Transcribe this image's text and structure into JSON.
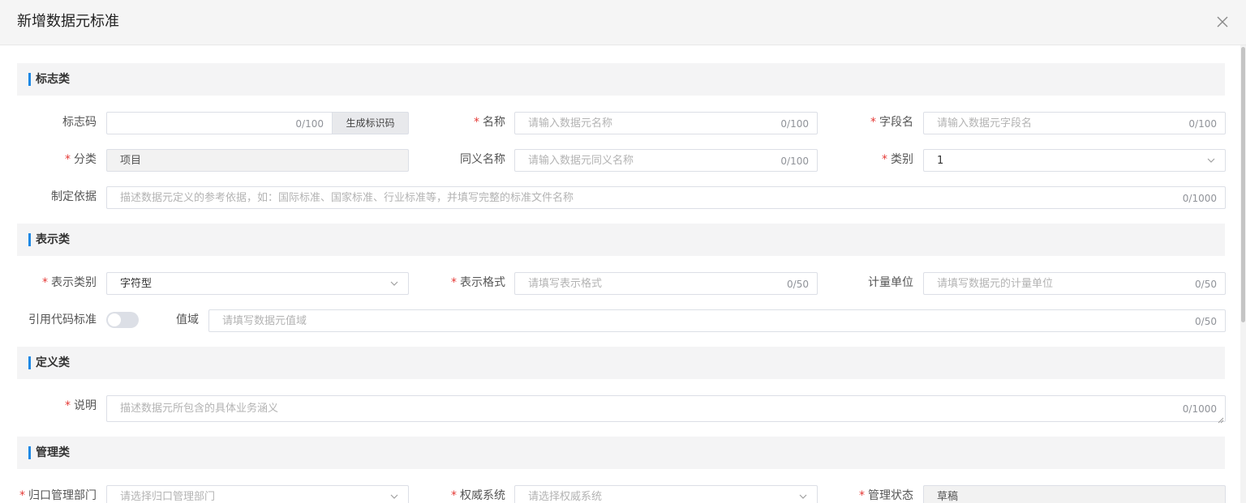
{
  "dialog": {
    "title": "新增数据元标准"
  },
  "sections": {
    "identity": "标志类",
    "representation": "表示类",
    "definition": "定义类",
    "management": "管理类"
  },
  "fields": {
    "id_code": {
      "label": "标志码",
      "value": "",
      "count": "0/100",
      "button": "生成标识码"
    },
    "name": {
      "label": "名称",
      "placeholder": "请输入数据元名称",
      "count": "0/100"
    },
    "field_name": {
      "label": "字段名",
      "placeholder": "请输入数据元字段名",
      "count": "0/100"
    },
    "classification": {
      "label": "分类",
      "value": "项目"
    },
    "synonym": {
      "label": "同义名称",
      "placeholder": "请输入数据元同义名称",
      "count": "0/100"
    },
    "category": {
      "label": "类别",
      "value": "1"
    },
    "basis": {
      "label": "制定依据",
      "placeholder": "描述数据元定义的参考依据，如：国际标准、国家标准、行业标准等，并填写完整的标准文件名称",
      "count": "0/1000"
    },
    "rep_type": {
      "label": "表示类别",
      "value": "字符型"
    },
    "rep_format": {
      "label": "表示格式",
      "placeholder": "请填写表示格式",
      "count": "0/50"
    },
    "unit": {
      "label": "计量单位",
      "placeholder": "请填写数据元的计量单位",
      "count": "0/50"
    },
    "code_ref": {
      "label": "引用代码标准",
      "on": false
    },
    "domain": {
      "label": "值域",
      "placeholder": "请填写数据元值域",
      "count": "0/50"
    },
    "description": {
      "label": "说明",
      "placeholder": "描述数据元所包含的具体业务涵义",
      "count": "0/1000"
    },
    "dept": {
      "label": "归口管理部门",
      "placeholder": "请选择归口管理部门"
    },
    "authority": {
      "label": "权威系统",
      "placeholder": "请选择权威系统"
    },
    "status": {
      "label": "管理状态",
      "value": "草稿"
    }
  },
  "icons": {
    "close": "close-icon",
    "arrow": "chevron-down-icon"
  },
  "colors": {
    "accent": "#1e88e5",
    "required": "#e53935"
  }
}
